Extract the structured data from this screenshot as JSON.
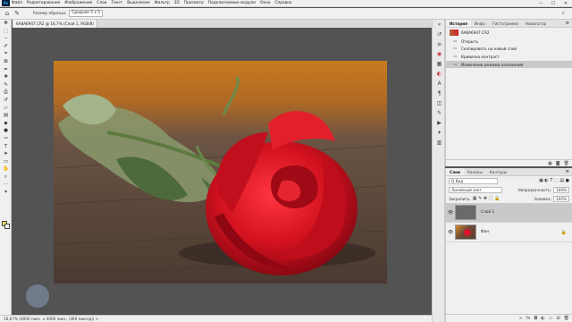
{
  "app": {
    "logo": "Ps"
  },
  "menu": [
    "Файл",
    "Редактирование",
    "Изображение",
    "Слои",
    "Текст",
    "Выделение",
    "Фильтр",
    "3D",
    "Просмотр",
    "Подключаемые модули",
    "Окно",
    "Справка"
  ],
  "window_controls": [
    "—",
    "☐",
    "✕"
  ],
  "options": {
    "size_label": "Размер образца:",
    "size_value": "Среднее 5 x 5"
  },
  "document_tab": {
    "title": "6A8A6947.CR2 @ 16,7% (Слой 1, RGB/8) *",
    "close": "×"
  },
  "status": {
    "text": "16,67%   (6000 пикс. x 4000 пикс. (300 пикс/д))   >"
  },
  "history_panel": {
    "tabs": [
      "История",
      "Инфо",
      "Гистограмма",
      "Навигатор"
    ],
    "snapshot": "6A8A6947.CR2",
    "items": [
      "Открыть",
      "Скопировать на новый слой",
      "Кривизна контраст",
      "Изменение режима наложения"
    ],
    "selected_index": 3
  },
  "layers_panel": {
    "tabs": [
      "Слои",
      "Каналы",
      "Контуры"
    ],
    "filter": "Q Вид",
    "blend_mode": "Линейный свет",
    "opacity_label": "Непрозрачность:",
    "opacity_value": "100%",
    "lock_label": "Закрепить:",
    "fill_label": "Заливка:",
    "fill_value": "100%",
    "layers": [
      {
        "name": "Слой 1",
        "visible": true,
        "selected": true
      },
      {
        "name": "Фон",
        "visible": true,
        "locked": true
      }
    ]
  },
  "colors": {
    "chrome": "#f0f0f0",
    "workspace": "#535353",
    "selection": "#c9c9c9",
    "foreground": "#f5e16a"
  }
}
